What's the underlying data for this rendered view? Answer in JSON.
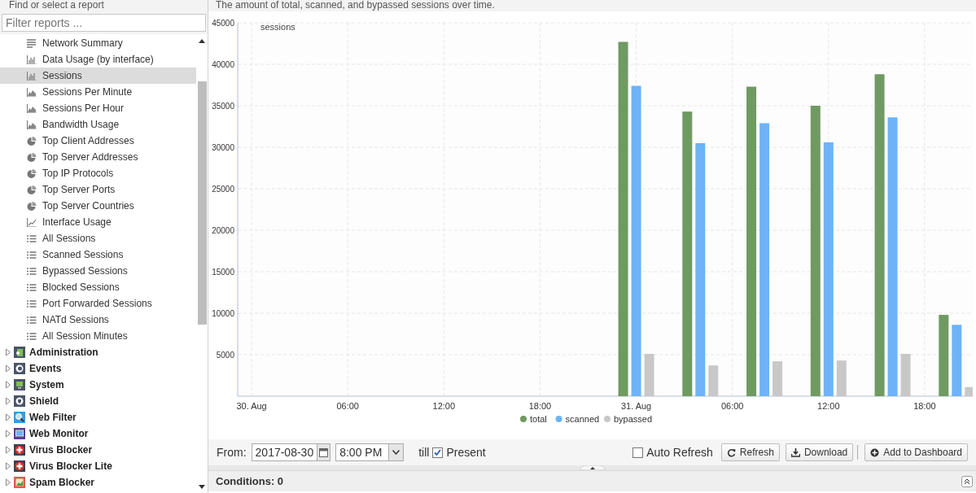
{
  "sidebar": {
    "title": "Find or select a report",
    "filter": {
      "placeholder": "Filter reports ..."
    },
    "reports": [
      {
        "label": "Network Summary",
        "kind": "text",
        "selected": false
      },
      {
        "label": "Data Usage (by interface)",
        "kind": "bar",
        "selected": false
      },
      {
        "label": "Sessions",
        "kind": "bar",
        "selected": true
      },
      {
        "label": "Sessions Per Minute",
        "kind": "area",
        "selected": false
      },
      {
        "label": "Sessions Per Hour",
        "kind": "area",
        "selected": false
      },
      {
        "label": "Bandwidth Usage",
        "kind": "area",
        "selected": false
      },
      {
        "label": "Top Client Addresses",
        "kind": "pie",
        "selected": false
      },
      {
        "label": "Top Server Addresses",
        "kind": "pie",
        "selected": false
      },
      {
        "label": "Top IP Protocols",
        "kind": "pie",
        "selected": false
      },
      {
        "label": "Top Server Ports",
        "kind": "pie",
        "selected": false
      },
      {
        "label": "Top Server Countries",
        "kind": "pie",
        "selected": false
      },
      {
        "label": "Interface Usage",
        "kind": "line",
        "selected": false
      },
      {
        "label": "All Sessions",
        "kind": "list",
        "selected": false
      },
      {
        "label": "Scanned Sessions",
        "kind": "list",
        "selected": false
      },
      {
        "label": "Bypassed Sessions",
        "kind": "list",
        "selected": false
      },
      {
        "label": "Blocked Sessions",
        "kind": "list",
        "selected": false
      },
      {
        "label": "Port Forwarded Sessions",
        "kind": "list",
        "selected": false
      },
      {
        "label": "NATd Sessions",
        "kind": "list",
        "selected": false
      },
      {
        "label": "All Session Minutes",
        "kind": "list",
        "selected": false
      }
    ],
    "categories": [
      {
        "label": "Administration",
        "kind": "admin",
        "expanded": false
      },
      {
        "label": "Events",
        "kind": "events",
        "expanded": false
      },
      {
        "label": "System",
        "kind": "system",
        "expanded": false
      },
      {
        "label": "Shield",
        "kind": "shield",
        "expanded": false
      },
      {
        "label": "Web Filter",
        "kind": "webfilter",
        "expanded": false
      },
      {
        "label": "Web Monitor",
        "kind": "webmonitor",
        "expanded": false
      },
      {
        "label": "Virus Blocker",
        "kind": "virus",
        "expanded": false
      },
      {
        "label": "Virus Blocker Lite",
        "kind": "virus",
        "expanded": false
      },
      {
        "label": "Spam Blocker",
        "kind": "spam",
        "expanded": false
      }
    ]
  },
  "report": {
    "description": "The amount of total, scanned, and bypassed sessions over time.",
    "chart_data": {
      "type": "bar",
      "ylabel": "sessions",
      "x": [
        "2017-08-31T00:00",
        "2017-08-31T04:00",
        "2017-08-31T08:00",
        "2017-08-31T12:00",
        "2017-08-31T16:00",
        "2017-08-31T20:00"
      ],
      "series": [
        {
          "name": "total",
          "color": "#6f9a62",
          "values": [
            42700,
            34300,
            37300,
            35000,
            38800,
            9800
          ]
        },
        {
          "name": "scanned",
          "color": "#6db3f7",
          "values": [
            37400,
            30500,
            32900,
            30600,
            33600,
            8600
          ]
        },
        {
          "name": "bypassed",
          "color": "#c8c8c8",
          "values": [
            5100,
            3700,
            4200,
            4300,
            5100,
            1100
          ]
        }
      ],
      "xlim": [
        "2017-08-29T23:08",
        "2017-08-31T21:00"
      ],
      "ylim": [
        0,
        45000
      ],
      "grid": true,
      "legend": "bottom",
      "xticks": [
        {
          "value": "2017-08-30T00:00",
          "label": "30. Aug"
        },
        {
          "value": "2017-08-30T06:00",
          "label": "06:00"
        },
        {
          "value": "2017-08-30T12:00",
          "label": "12:00"
        },
        {
          "value": "2017-08-30T18:00",
          "label": "18:00"
        },
        {
          "value": "2017-08-31T00:00",
          "label": "31. Aug"
        },
        {
          "value": "2017-08-31T06:00",
          "label": "06:00"
        },
        {
          "value": "2017-08-31T12:00",
          "label": "12:00"
        },
        {
          "value": "2017-08-31T18:00",
          "label": "18:00"
        }
      ],
      "yticks": [
        5000,
        10000,
        15000,
        20000,
        25000,
        30000,
        35000,
        40000,
        45000
      ]
    }
  },
  "toolbar": {
    "from_label": "From:",
    "date": "2017-08-30",
    "time": "8:00 PM",
    "till_label": "till",
    "present": {
      "label": "Present",
      "checked": true
    },
    "auto_refresh": {
      "label": "Auto Refresh",
      "checked": false
    },
    "buttons": [
      {
        "label": "Refresh",
        "kind": "refresh"
      },
      {
        "label": "Download",
        "kind": "download"
      },
      {
        "label": "Add to Dashboard",
        "kind": "add"
      }
    ]
  },
  "conditions": {
    "label": "Conditions: 0"
  }
}
